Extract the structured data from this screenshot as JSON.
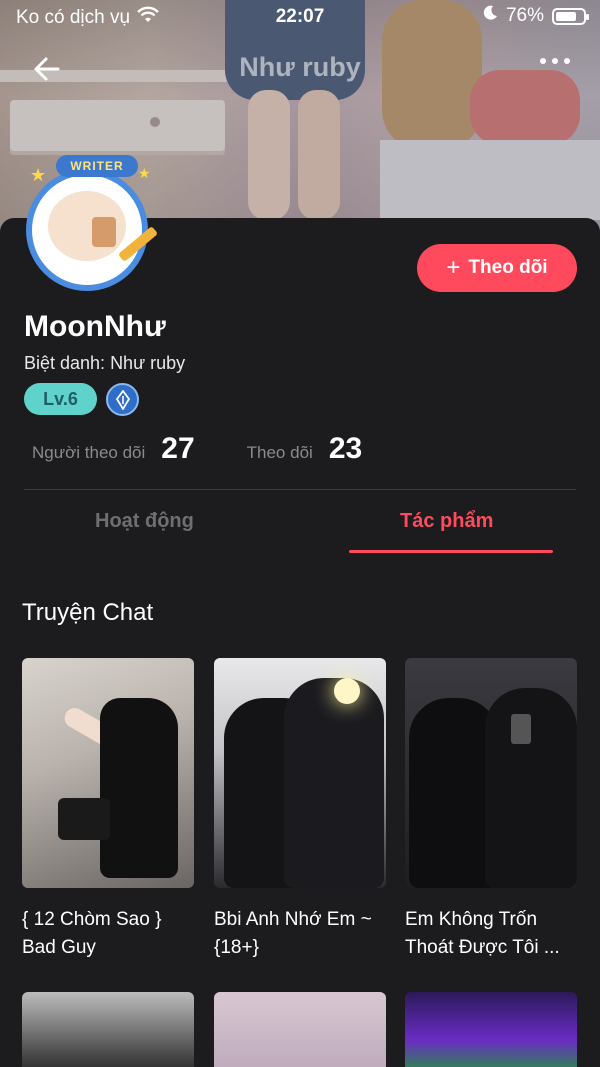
{
  "status_bar": {
    "carrier": "Ko có dịch vụ",
    "time": "22:07",
    "battery_percent": "76%",
    "battery_level": 0.76
  },
  "nav": {
    "title": "Như ruby",
    "back_icon": "arrow-left-icon",
    "more_icon": "more-dots-icon"
  },
  "profile": {
    "avatar_tag": "WRITER",
    "username": "MoonNhư",
    "nickname": "Biệt danh: Như ruby",
    "level": "Lv.6",
    "follow_button": "Theo dõi",
    "follow_icon": "plus-icon",
    "stats": [
      {
        "label": "Người theo dõi",
        "value": "27"
      },
      {
        "label": "Theo dõi",
        "value": "23"
      }
    ]
  },
  "tabs": [
    {
      "label": "Hoạt động",
      "active": false
    },
    {
      "label": "Tác phẩm",
      "active": true
    }
  ],
  "section": {
    "title": "Truyện Chat",
    "items": [
      {
        "title": "{ 12 Chòm Sao } Bad Guy"
      },
      {
        "title": "Bbi Anh Nhớ Em ~ {18+}"
      },
      {
        "title": "Em Không Trốn Thoát Được Tôi ..."
      }
    ]
  },
  "colors": {
    "accent": "#ff4a5e",
    "background": "#1c1c1e",
    "level_badge": "#5fd3cb"
  }
}
